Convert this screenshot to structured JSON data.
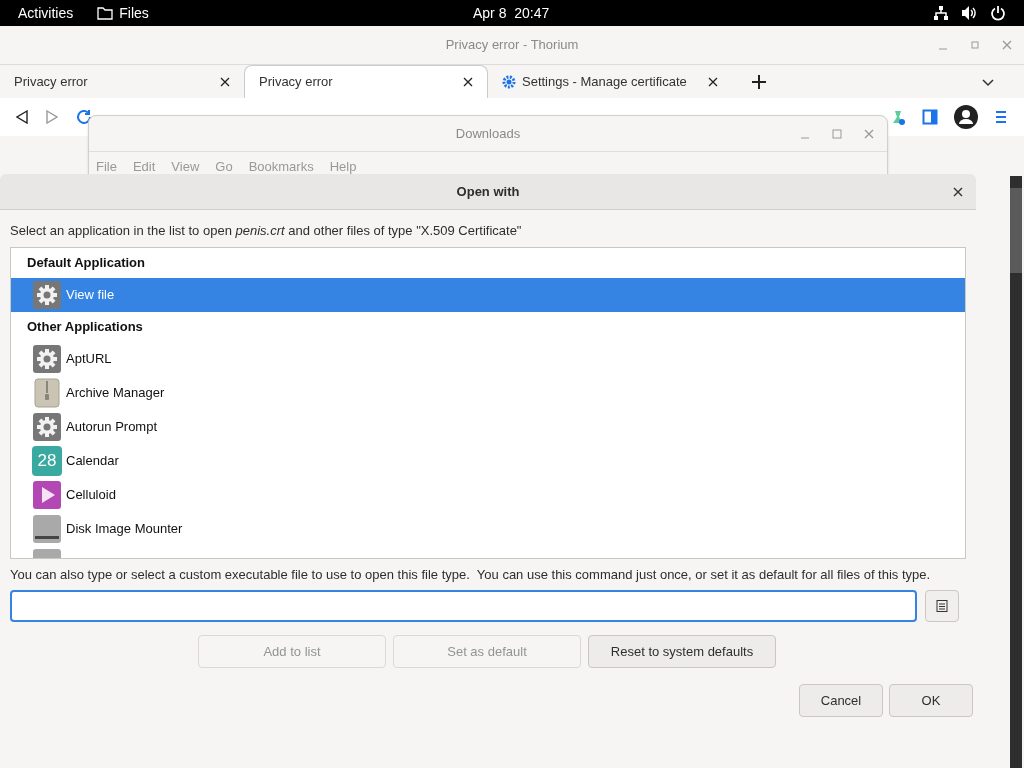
{
  "top_bar": {
    "activities": "Activities",
    "app": "Files",
    "clock": "Apr 8  20:47"
  },
  "browser": {
    "title": "Privacy error - Thorium",
    "tabs": [
      {
        "label": "Privacy error",
        "selected": false,
        "kind": "page"
      },
      {
        "label": "Privacy error",
        "selected": true,
        "kind": "page"
      },
      {
        "label": "Settings - Manage certificate",
        "selected": false,
        "kind": "settings"
      }
    ]
  },
  "downloads_window": {
    "title": "Downloads",
    "menu": [
      "File",
      "Edit",
      "View",
      "Go",
      "Bookmarks",
      "Help"
    ]
  },
  "dialog": {
    "title": "Open with",
    "prompt": "Select an application in the list to open *penis.crt* and other files of type \"X.509 Certificate\"",
    "sections": [
      {
        "heading": "Default Application",
        "items": [
          {
            "name": "View file",
            "kind": "gear",
            "selected": true
          }
        ]
      },
      {
        "heading": "Other Applications",
        "items": [
          {
            "name": "AptURL",
            "kind": "gear",
            "selected": false
          },
          {
            "name": "Archive Manager",
            "kind": "archive",
            "selected": false
          },
          {
            "name": "Autorun Prompt",
            "kind": "gear",
            "selected": false
          },
          {
            "name": "Calendar",
            "kind": "calendar",
            "icon_text": "28",
            "selected": false
          },
          {
            "name": "Celluloid",
            "kind": "play",
            "selected": false
          },
          {
            "name": "Disk Image Mounter",
            "kind": "disk",
            "selected": false
          },
          {
            "kind": "disk",
            "selected": false
          }
        ]
      }
    ],
    "hint": "You can also type or select a custom executable file to use to open this file type.  You can use this command just once, or set it as default for all files of this type.",
    "actions": [
      {
        "label": "Add to list",
        "disabled": true
      },
      {
        "label": "Set as default",
        "disabled": true
      },
      {
        "label": "Reset to system defaults",
        "disabled": false
      }
    ],
    "footer": [
      {
        "label": "Cancel"
      },
      {
        "label": "OK"
      }
    ]
  }
}
